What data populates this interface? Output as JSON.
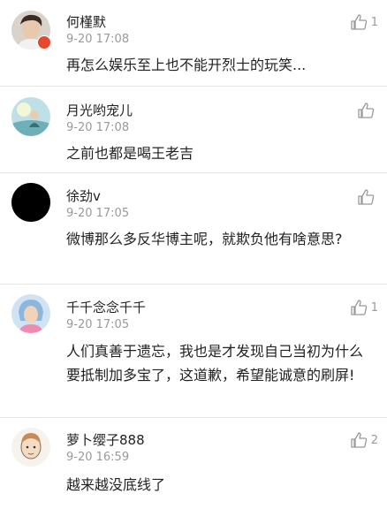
{
  "comments": [
    {
      "name": "何槿默",
      "time": "9-20 17:08",
      "text": "再怎么娱乐至上也不能开烈士的玩笑...",
      "likes": "1",
      "icons": {
        "avatar": "avatar-photo",
        "like": "thumbs-up-icon",
        "badge": "vip-badge-icon"
      }
    },
    {
      "name": "月光哟宠儿",
      "time": "9-20 17:08",
      "text": "之前也都是喝王老吉",
      "likes": "",
      "icons": {
        "avatar": "avatar-photo",
        "like": "thumbs-up-icon"
      }
    },
    {
      "name": "徐劲v",
      "time": "9-20 17:05",
      "text": "微博那么多反华博主呢，就欺负他有啥意思?",
      "likes": "",
      "icons": {
        "avatar": "avatar-black",
        "like": "thumbs-up-icon"
      }
    },
    {
      "name": "千千念念千千",
      "time": "9-20 17:05",
      "text": "人们真善于遗忘，我也是才发现自己当初为什么要抵制加多宝了，这道歉，希望能诚意的刷屏!",
      "likes": "1",
      "icons": {
        "avatar": "avatar-photo",
        "like": "thumbs-up-icon"
      }
    },
    {
      "name": "萝卜缨子888",
      "time": "9-20 16:59",
      "text": "越来越没底线了",
      "likes": "2",
      "icons": {
        "avatar": "avatar-drawing",
        "like": "thumbs-up-icon"
      }
    }
  ],
  "colors": {
    "muted": "#999999",
    "text": "#222222",
    "divider": "#e6e6e6",
    "badge": "#e8462d"
  }
}
